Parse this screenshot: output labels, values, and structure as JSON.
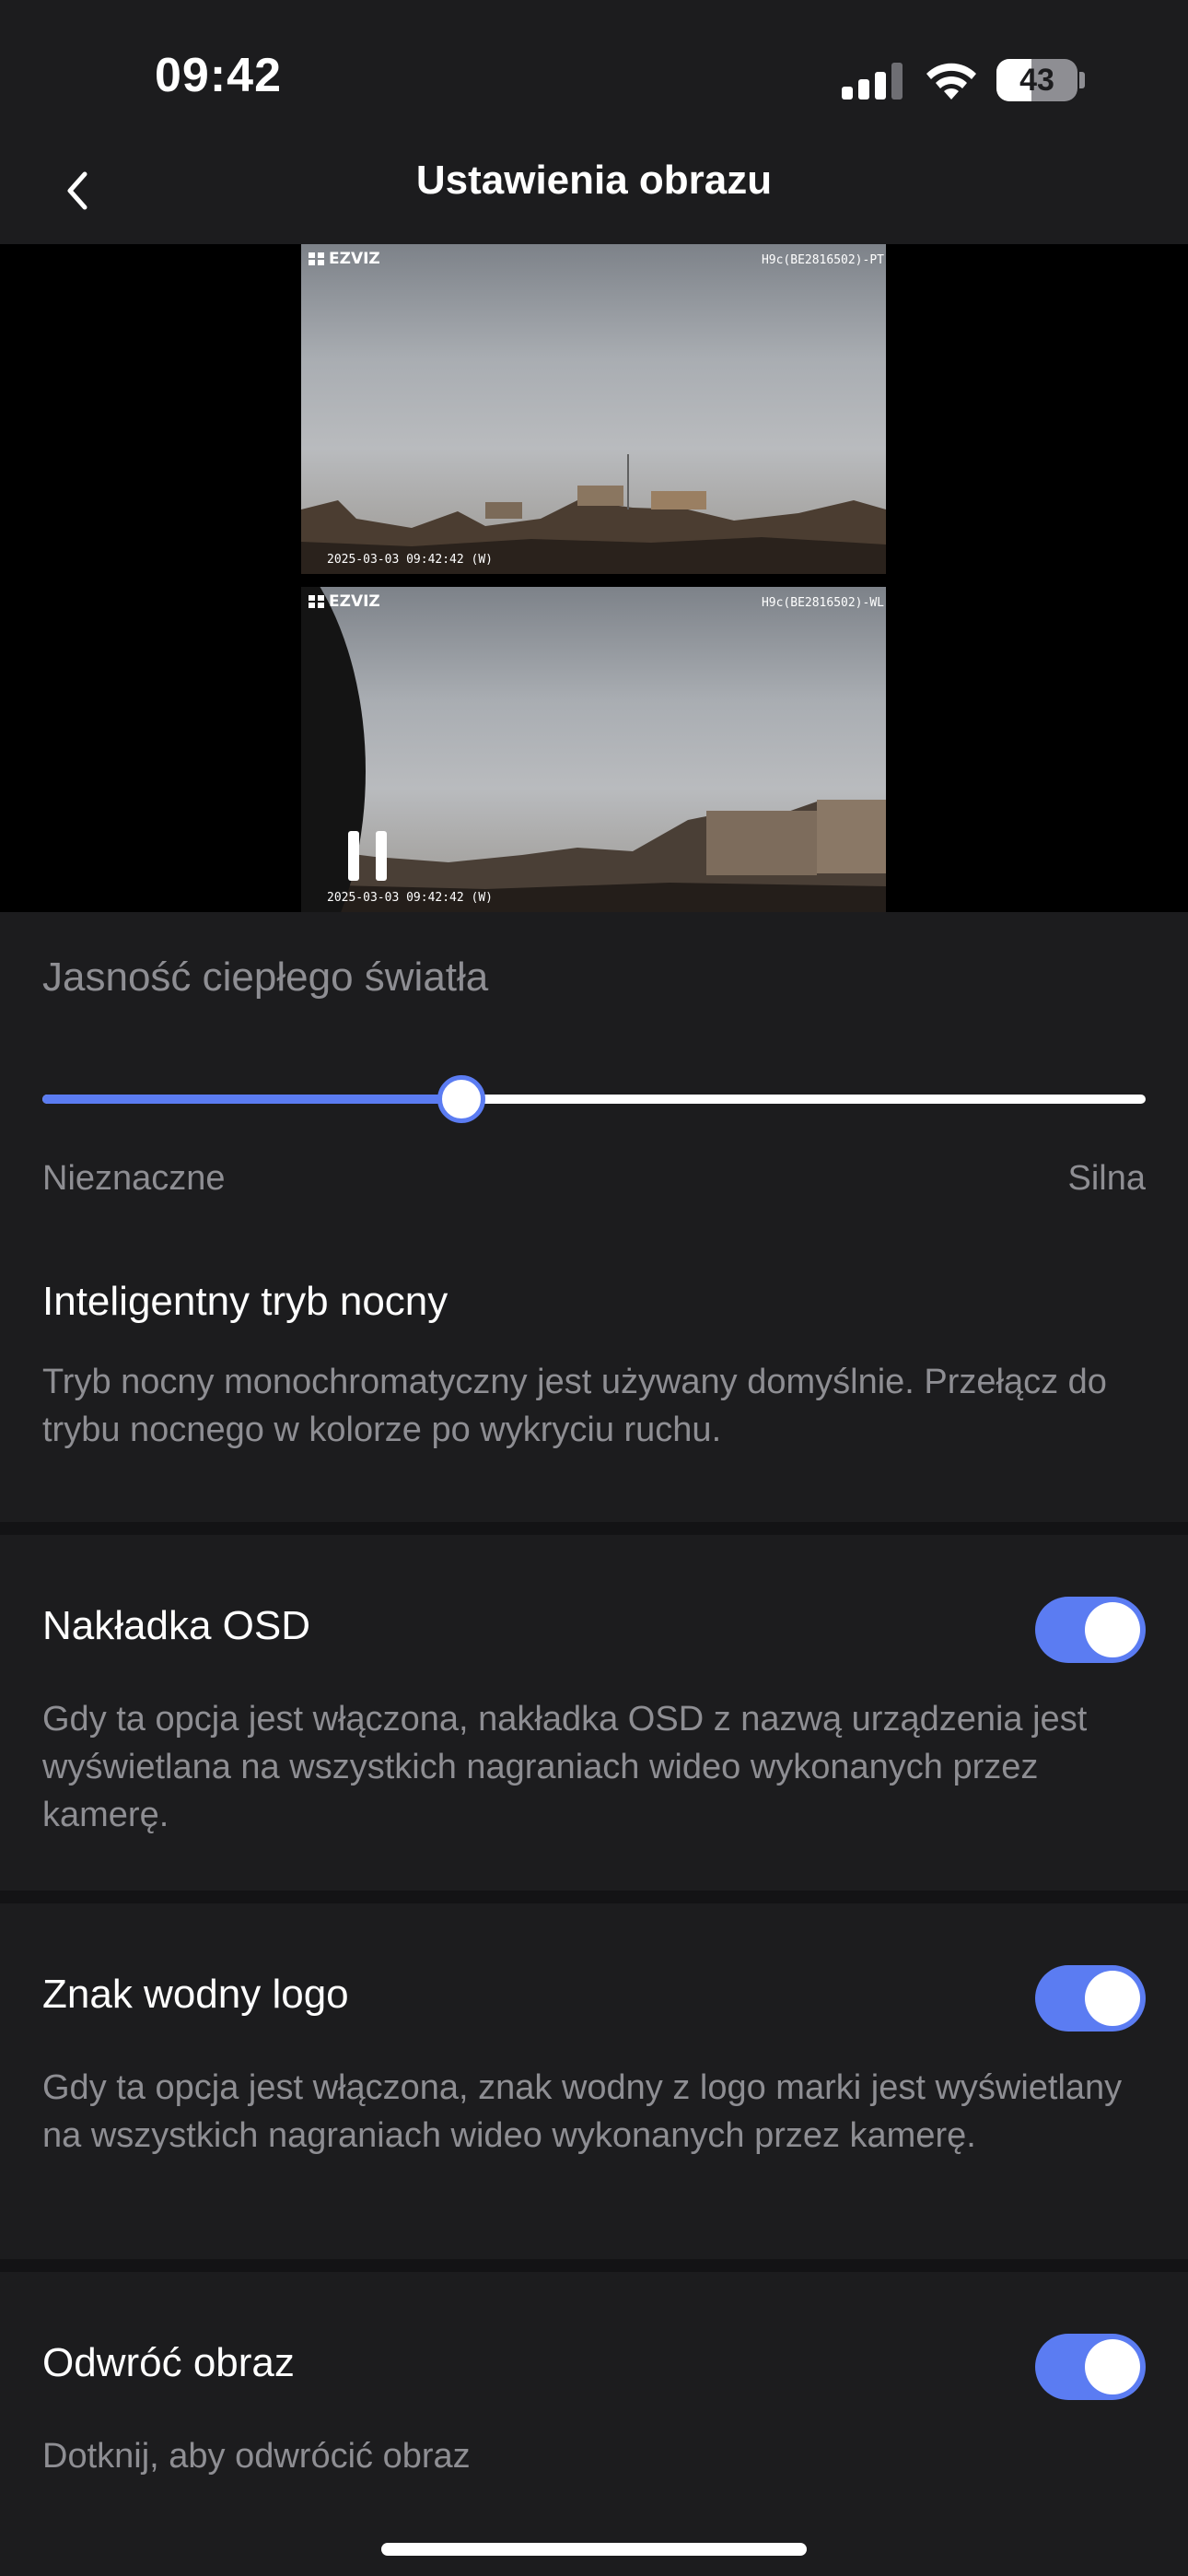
{
  "status_bar": {
    "time": "09:42",
    "battery_percent": "43",
    "battery_level": 0.43,
    "signal_icon": "cellular-signal-icon",
    "wifi_icon": "wifi-icon"
  },
  "nav": {
    "title": "Ustawienia obrazu",
    "back_icon": "chevron-left-icon"
  },
  "video": {
    "brand": "EZVIZ",
    "top_feed": {
      "device_label": "H9c(BE2816502)-PT",
      "timestamp": "2025-03-03 09:42:42  (W)"
    },
    "bottom_feed": {
      "device_label": "H9c(BE2816502)-WL",
      "timestamp": "2025-03-03 09:42:42  (W)"
    },
    "pause_icon": "pause-icon"
  },
  "warm_light": {
    "title": "Jasność ciepłego światła",
    "min_label": "Nieznaczne",
    "max_label": "Silna",
    "value_fraction": 0.38
  },
  "smart_night": {
    "title": "Inteligentny tryb nocny",
    "description": "Tryb nocny monochromatyczny jest używany domyślnie. Przełącz do trybu nocnego w kolorze po wykryciu ruchu."
  },
  "osd": {
    "title": "Nakładka OSD",
    "description": "Gdy ta opcja jest włączona, nakładka OSD z nazwą urządzenia jest wyświetlana na wszystkich nagraniach wideo wykonanych przez kamerę.",
    "enabled": true
  },
  "watermark": {
    "title": "Znak wodny logo",
    "description": "Gdy ta opcja jest włączona, znak wodny z logo marki jest wyświetlany na wszystkich nagraniach wideo wykonanych przez kamerę.",
    "enabled": true
  },
  "flip": {
    "title": "Odwróć obraz",
    "description": "Dotknij, aby odwrócić obraz",
    "enabled": true
  },
  "colors": {
    "accent": "#5b7cf2",
    "background": "#1c1c1e",
    "secondary_text": "#8e8e93"
  }
}
